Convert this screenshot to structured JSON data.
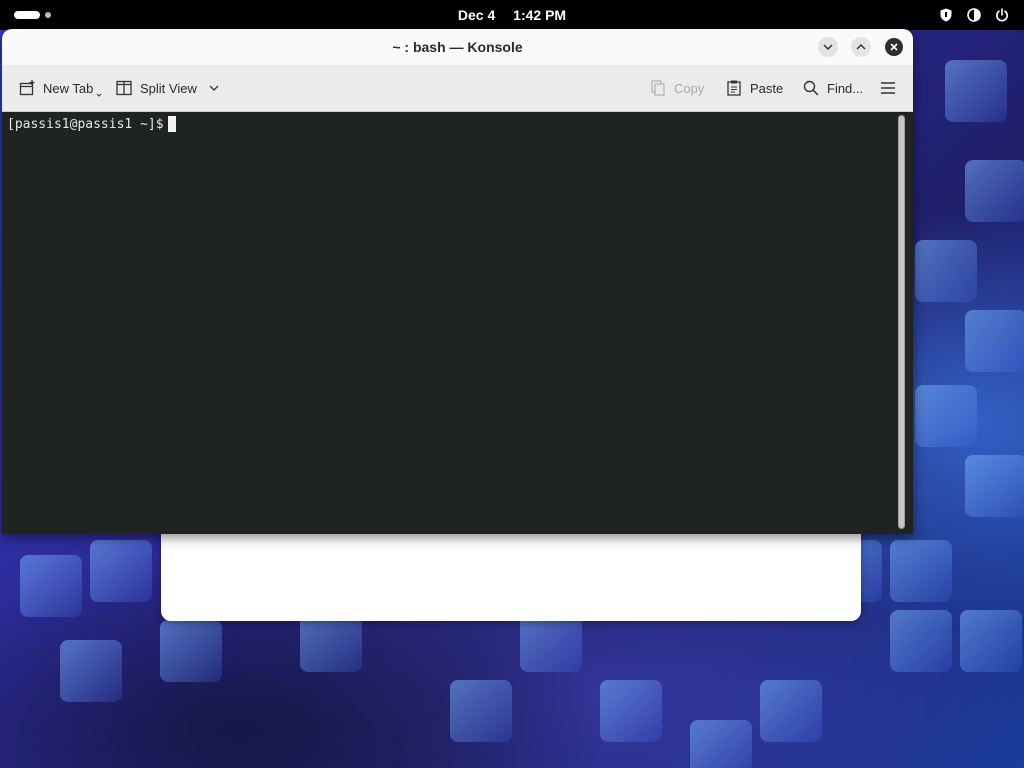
{
  "top_panel": {
    "date": "Dec 4",
    "time": "1:42 PM",
    "tray_icons": [
      "shield-icon",
      "audio-icon",
      "power-icon"
    ]
  },
  "window": {
    "title": "~ : bash — Konsole"
  },
  "toolbar": {
    "new_tab_label": "New Tab",
    "split_view_label": "Split View",
    "copy_label": "Copy",
    "paste_label": "Paste",
    "find_label": "Find..."
  },
  "terminal": {
    "prompt": "[passis1@passis1 ~]$"
  },
  "colors": {
    "terminal_background": "#1f2423",
    "titlebar_background": "#fafafa",
    "toolbar_background": "#ebebeb",
    "top_panel_background": "#000000"
  }
}
